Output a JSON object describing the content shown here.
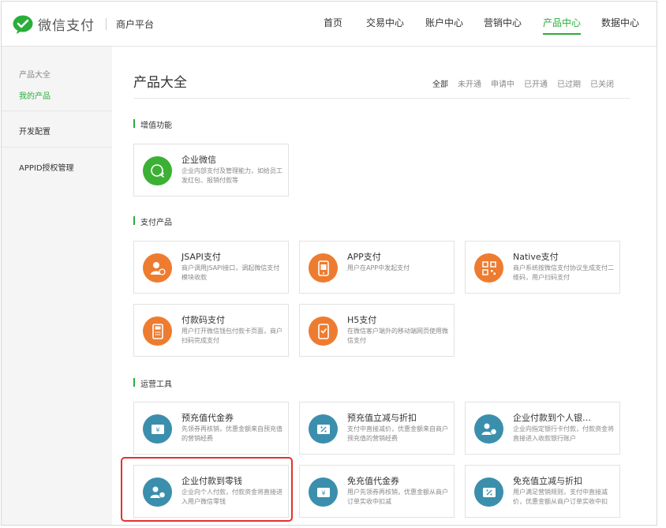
{
  "header": {
    "logo_text": "微信支付",
    "merchant_label": "商户平台",
    "nav": [
      "首页",
      "交易中心",
      "账户中心",
      "营销中心",
      "产品中心",
      "数据中心"
    ],
    "active_nav": "产品中心"
  },
  "sidebar": {
    "section_title": "产品大全",
    "items": [
      {
        "label": "我的产品",
        "active": true
      },
      {
        "label": "开发配置",
        "active": false
      },
      {
        "label": "APPID授权管理",
        "active": false
      }
    ]
  },
  "main": {
    "title": "产品大全",
    "filters": [
      "全部",
      "未开通",
      "申请中",
      "已开通",
      "已过期",
      "已关闭"
    ],
    "active_filter": "全部",
    "sections": [
      {
        "label": "增值功能",
        "cards": [
          {
            "title": "企业微信",
            "desc": "企业内部支付及管理能力，如给员工发红包、报销付款等",
            "icon": "wecom-icon",
            "color": "#3cb034"
          }
        ]
      },
      {
        "label": "支付产品",
        "cards": [
          {
            "title": "JSAPI支付",
            "desc": "商户调用JSAPI接口，调起微信支付模块收款",
            "icon": "user-pay-icon",
            "color": "#ee7c30"
          },
          {
            "title": "APP支付",
            "desc": "用户在APP中发起支付",
            "icon": "app-pay-icon",
            "color": "#ee7c30"
          },
          {
            "title": "Native支付",
            "desc": "商户系统按微信支付协议生成支付二维码，用户扫码支付",
            "icon": "qrcode-icon",
            "color": "#ee7c30"
          },
          {
            "title": "付款码支付",
            "desc": "用户打开微信钱包付款卡页面，商户扫码完成支付",
            "icon": "pos-icon",
            "color": "#ee7c30"
          },
          {
            "title": "H5支付",
            "desc": "在微信客户端外的移动端网页使用微信支付",
            "icon": "h5-pay-icon",
            "color": "#ee7c30"
          }
        ]
      },
      {
        "label": "运营工具",
        "cards": [
          {
            "title": "预充值代金券",
            "desc": "先领券再核销，优惠金额来自预充值的营销经费",
            "icon": "coupon-icon",
            "color": "#3b8fad"
          },
          {
            "title": "预充值立减与折扣",
            "desc": "支付中直接减价，优惠金额来自商户预充值的营销经费",
            "icon": "discount-icon",
            "color": "#3b8fad"
          },
          {
            "title": "企业付款到个人银…",
            "desc": "企业向指定银行卡付款，付款资金将直接进入收款银行账户",
            "icon": "bank-transfer-icon",
            "color": "#3b8fad"
          },
          {
            "title": "企业付款到零钱",
            "desc": "企业向个人付款，付款资金将直接进入用户微信零钱",
            "icon": "wallet-transfer-icon",
            "color": "#3b8fad"
          },
          {
            "title": "免充值代金券",
            "desc": "用户先领券再核销，优惠金额从商户订单实收中扣减",
            "icon": "coupon-icon",
            "color": "#3b8fad"
          },
          {
            "title": "免充值立减与折扣",
            "desc": "用户满足营销规则，支付中直接减价，优惠金额从商户订单实收中扣",
            "icon": "discount-icon",
            "color": "#3b8fad"
          }
        ]
      }
    ]
  },
  "colors": {
    "brand_green": "#2aae3b",
    "highlight_red": "#e0342f"
  }
}
